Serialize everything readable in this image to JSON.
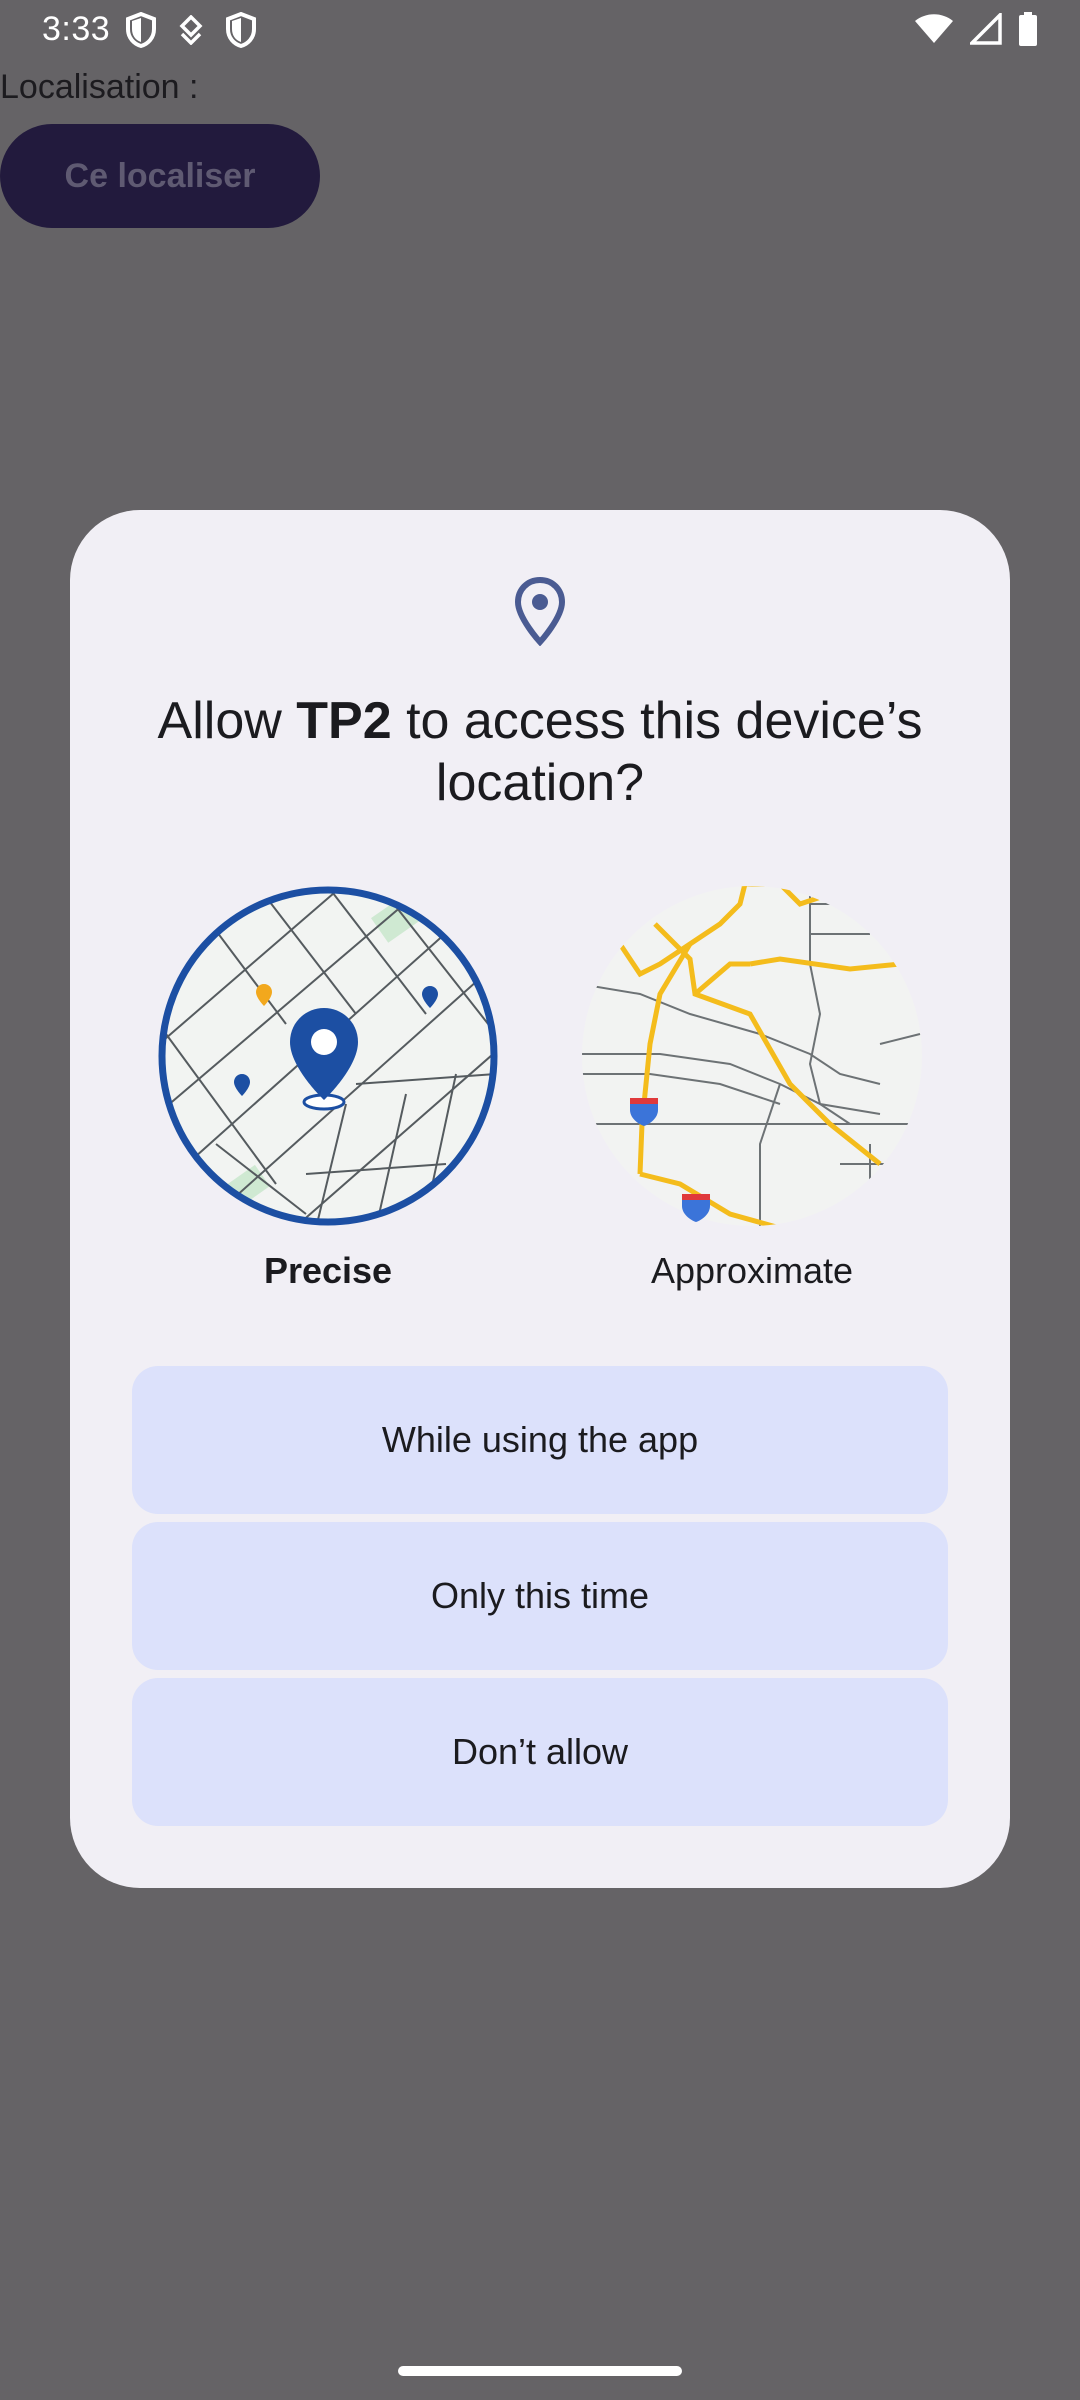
{
  "status_bar": {
    "time": "3:33",
    "left_icons": [
      "shield-icon",
      "data-saver-icon",
      "shield-icon"
    ],
    "right_icons": [
      "wifi-icon",
      "cell-signal-icon",
      "battery-icon"
    ]
  },
  "app": {
    "location_label": "Localisation :",
    "locate_button": "Ce localiser"
  },
  "dialog": {
    "title_prefix": "Allow ",
    "app_name": "TP2",
    "title_suffix": " to access this device’s location?",
    "options": [
      {
        "label": "Precise",
        "selected": true
      },
      {
        "label": "Approximate",
        "selected": false
      }
    ],
    "buttons": {
      "while_using": "While using the app",
      "only_this_time": "Only this time",
      "dont_allow": "Don’t allow"
    }
  },
  "colors": {
    "scrim": "#656366",
    "dialog_bg": "#f1eff5",
    "button_bg": "#dce1fb",
    "accent_blue": "#1c4fa3",
    "road_yellow": "#f4bc1c"
  }
}
